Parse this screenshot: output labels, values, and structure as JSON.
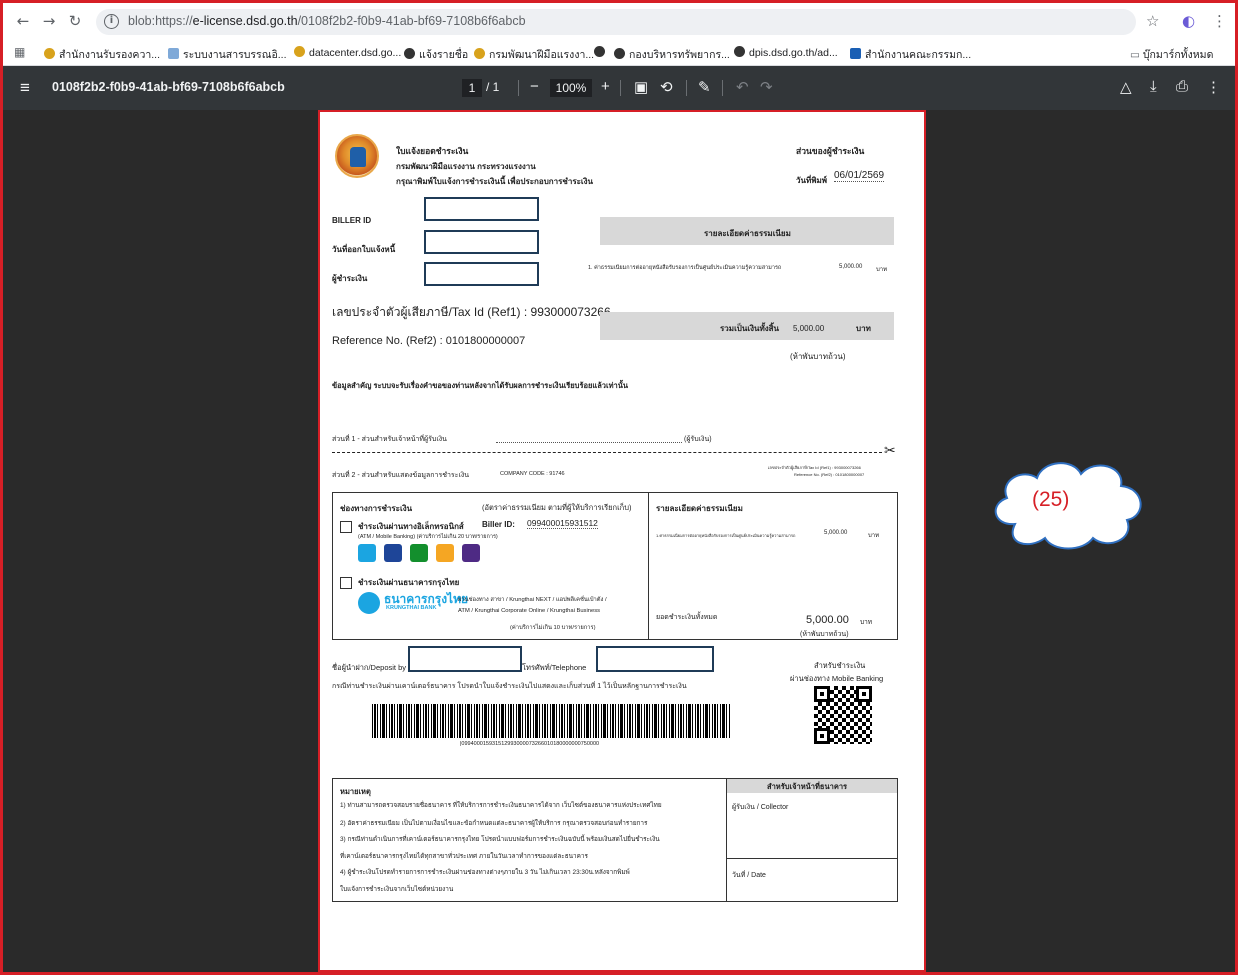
{
  "browser": {
    "url_prefix": "blob:https://",
    "url_host": "e-license.dsd.go.th",
    "url_path": "/0108f2b2-f0b9-41ab-bf69-7108b6f6abcb",
    "bookmarks": [
      "สำนักงานรับรองควา...",
      "ระบบงานสารบรรณอิ...",
      "datacenter.dsd.go...",
      "แจ้งรายชื่อ",
      "กรมพัฒนาฝีมือแรงงา...",
      "กองบริหารทรัพยากร...",
      "dpis.dsd.go.th/ad...",
      "สำนักงานคณะกรรมก..."
    ],
    "all_bookmarks": "บุ๊กมาร์กทั้งหมด"
  },
  "pdf_toolbar": {
    "file_name": "0108f2b2-f0b9-41ab-bf69-7108b6f6abcb",
    "page_current": "1",
    "page_total": "/ 1",
    "zoom": "100%"
  },
  "doc": {
    "title": "ใบแจ้งยอดชำระเงิน",
    "dept": "กรมพัฒนาฝีมือแรงงาน กระทรวงแรงงาน",
    "instruction": "กรุณาพิมพ์ใบแจ้งการชำระเงินนี้ เพื่อประกอบการชำระเงิน",
    "payer_part": "ส่วนของผู้ชำระเงิน",
    "print_date_label": "วันที่พิมพ์",
    "print_date": "06/01/2569",
    "biller_id_label": "BILLER ID",
    "issue_date_label": "วันที่ออกใบแจ้งหนี้",
    "payer_label": "ผู้ชำระเงิน",
    "tax_id": "เลขประจำตัวผู้เสียภาษี/Tax Id (Ref1) : 993000073266",
    "ref2": "Reference No. (Ref2) : 0101800000007",
    "fee_detail_header": "รายละเอียดค่าธรรมเนียม",
    "fee_line": "1. ค่าธรรมเนียมการต่ออายุหนังสือรับรองการเป็นศูนย์ประเมินความรู้ความสามารถ",
    "fee_amount": "5,000.00",
    "fee_unit": "บาท",
    "total_label": "รวมเป็นเงินทั้งสิ้น",
    "total_amount": "5,000.00",
    "total_unit": "บาท",
    "total_words": "(ห้าพันบาทถ้วน)",
    "important": "ข้อมูลสำคัญ  ระบบจะรับเรื่องคำขอของท่านหลังจากได้รับผลการชำระเงินเรียบร้อยแล้วเท่านั้น",
    "part1": "ส่วนที่ 1 - ส่วนสำหรับเจ้าหน้าที่ผู้รับเงิน",
    "part1_end": "(ผู้รับเงิน)",
    "part2": "ส่วนที่ 2 - ส่วนสำหรับแสดงข้อมูลการชำระเงิน",
    "company_code": "COMPANY CODE : 91746",
    "small_tax": "เลขประจำตัวผู้เสียภาษี/Tax Id (Ref1) : 993000073266",
    "small_ref": "Reference No. (Ref2) : 0101800000007",
    "channels_header": "ช่องทางการชำระเงิน",
    "channels_note": "(อัตราค่าธรรมเนียม ตามที่ผู้ให้บริการเรียกเก็บ)",
    "ebank_label": "ชำระเงินผ่านทางอิเล็กทรอนิกส์",
    "biller_id_caption": "Biller ID:",
    "biller_id_value": "099400015931512",
    "ebank_sub": "(ATM / Mobile Banking) (ค่าบริการไม่เกิน 20 บาท/รายการ)",
    "ktb_label": "ชำระเงินผ่านธนาคารกรุงไทย",
    "ktb_logo_th": "ธนาคารกรุงไทย",
    "ktb_logo_en": "KRUNGTHAI BANK",
    "ktb_desc1": "ผ่านช่องทาง สาขา / Krungthai NEXT / แอปพลิเคชั่นเป๋าตัง /",
    "ktb_desc2": "ATM /  Krungthai Corporate Online / Krungthai Business",
    "ktb_desc3": "(ค่าบริการไม่เกิน 10 บาท/รายการ)",
    "fee_detail2": "รายละเอียดค่าธรรมเนียม",
    "fee_line2": "1.ค่าธรรมเนียมการต่ออายุหนังสือรับรองการเป็นศูนย์ประเมินความรู้ความสามารถ",
    "fee_amount2": "5,000.00",
    "fee_unit2": "บาท",
    "grand_label": "ยอดชำระเงินทั้งหมด",
    "grand_amount": "5,000.00",
    "grand_unit": "บาท",
    "grand_words": "(ห้าพันบาทถ้วน)",
    "deposit_label": "ชื่อผู้นำฝาก/Deposit by",
    "phone_label": "โทรศัพท์/Telephone",
    "mobile1": "สำหรับชำระเงิน",
    "mobile2": "ผ่านช่องทาง Mobile Banking",
    "counter_note": "กรณีท่านชำระเงินผ่านเคาน์เตอร์ธนาคาร โปรดนำใบแจ้งชำระเงินไปแสดงและเก็บส่วนที่ 1 ไว้เป็นหลักฐานการชำระเงิน",
    "barcode_text": "|099400015931512993000073266010180000000750000",
    "remarks_title": "หมายเหตุ",
    "remark1": "1) ท่านสามารถตรวจสอบรายชื่อธนาคาร ที่ให้บริการการชำระเงินธนาคารได้จาก เว็บไซต์ของธนาคารแห่งประเทศไทย",
    "remark2": "2) อัตราค่าธรรมเนียม เป็นไปตามเงื่อนไขและข้อกำหนดแต่ละธนาคารผู้ให้บริการ กรุณาตรวจสอบก่อนทำรายการ",
    "remark3a": "3) กรณีท่านดำเนินการที่เคาน์เตอร์ธนาคารกรุงไทย โปรดนำแบบฟอร์มการชำระเงินฉบับนี้ พร้อมเงินสดไปยื่นชำระเงิน",
    "remark3b": "ที่เคาน์เตอร์ธนาคารกรุงไทยได้ทุกสาขาทั่วประเทศ ภายในวันเวลาทำการของแต่ละธนาคาร",
    "remark4a": "4) ผู้ชำระเงินโปรดทำรายการการชำระเงินผ่านช่องทางต่างๆภายใน 3 วัน ไม่เกินเวลา 23:30น.หลังจากพิมพ์",
    "remark4b": "ใบแจ้งการชำระเงินจากเว็บไซต์หน่วยงาน",
    "bank_staff": "สำหรับเจ้าหน้าที่ธนาคาร",
    "collector": "ผู้รับเงิน / Collector",
    "date_label": "วันที่ / Date"
  },
  "callout": "(25)",
  "colors": {
    "accent_red": "#d61f26",
    "redaction_border": "#1f3b57",
    "pdf_toolbar": "#323639"
  }
}
